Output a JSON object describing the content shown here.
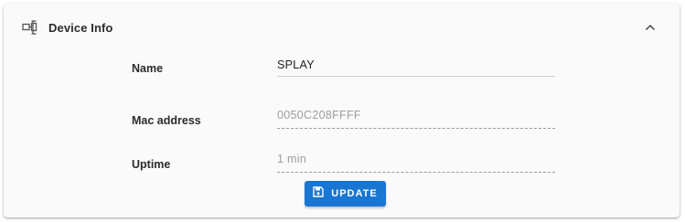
{
  "panel": {
    "title": "Device Info",
    "header_icon": "device-icon",
    "collapse_icon": "chevron-up-icon"
  },
  "fields": {
    "name": {
      "label": "Name",
      "value": "SPLAY"
    },
    "mac": {
      "label": "Mac address",
      "value": "0050C208FFFF"
    },
    "uptime": {
      "label": "Uptime",
      "value": "1 min"
    }
  },
  "actions": {
    "update_label": "UPDATE",
    "update_icon": "save-icon"
  },
  "colors": {
    "accent": "#1976d2",
    "text": "#2b2b2b",
    "disabled_text": "#9e9e9e"
  }
}
